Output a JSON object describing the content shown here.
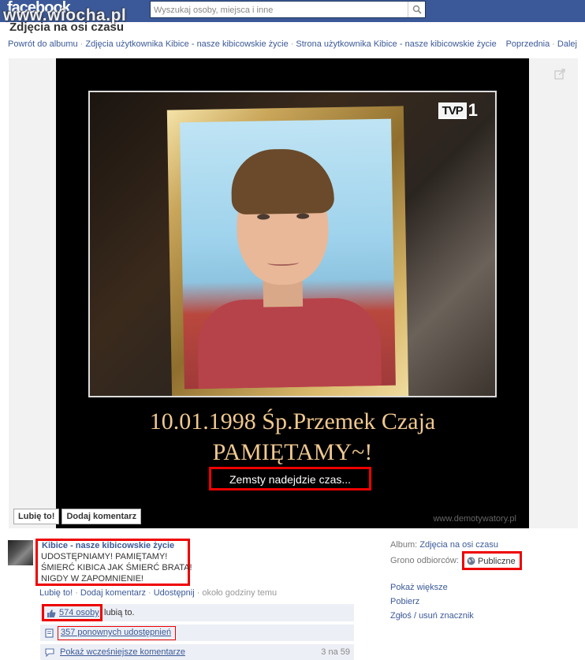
{
  "header": {
    "logo": "facebook",
    "search": {
      "placeholder": "Wyszukaj osoby, miejsca i inne"
    },
    "watermark": "www.wiocha.pl"
  },
  "page": {
    "title": "Zdjęcia na osi czasu"
  },
  "breadcrumb": [
    "Powrót do albumu",
    "Zdjęcia użytkownika Kibice - nasze kibicowskie życie",
    "Strona użytkownika Kibice - nasze kibicowskie życie"
  ],
  "nav": {
    "previous": "Poprzednia",
    "next": "Dalej"
  },
  "photo": {
    "channel_logo": "TVP",
    "channel_number": "1",
    "caption_line1": "10.01.1998 Śp.Przemek Czaja",
    "caption_line2": "PAMIĘTAMY~!",
    "caption_line3": "Zemsty nadejdzie czas...",
    "credit": "www.demotywatory.pl"
  },
  "photo_actions": {
    "like": "Lubię to!",
    "comment": "Dodaj komentarz"
  },
  "post": {
    "author": "Kibice - nasze kibicowskie życie",
    "lines": [
      "UDOSTĘPNIAMY! PAMIĘTAMY!",
      "ŚMIERĆ KIBICA JAK ŚMIERĆ BRATA!",
      "NIGDY W ZAPOMNIENIE!"
    ],
    "actions": {
      "like": "Lubię to!",
      "comment": "Dodaj komentarz",
      "share": "Udostępnij",
      "time": "około godziny temu"
    },
    "likes": {
      "count": "574 osoby",
      "suffix": "lubią to."
    },
    "shares": {
      "count": "357 ponownych udostępnień"
    },
    "comments": {
      "older": "Pokaż wcześniejsze komentarze",
      "count": "3 na 59"
    }
  },
  "meta": {
    "album_label": "Album:",
    "album_value": "Zdjęcia na osi czasu",
    "audience_label": "Grono odbiorców:",
    "audience_value": "Publiczne"
  },
  "side_links": [
    "Pokaż większe",
    "Pobierz",
    "Zgłoś / usuń znacznik"
  ],
  "colors": {
    "brand": "#3b5998",
    "highlight": "#e00000",
    "caption": "#f0c890"
  }
}
